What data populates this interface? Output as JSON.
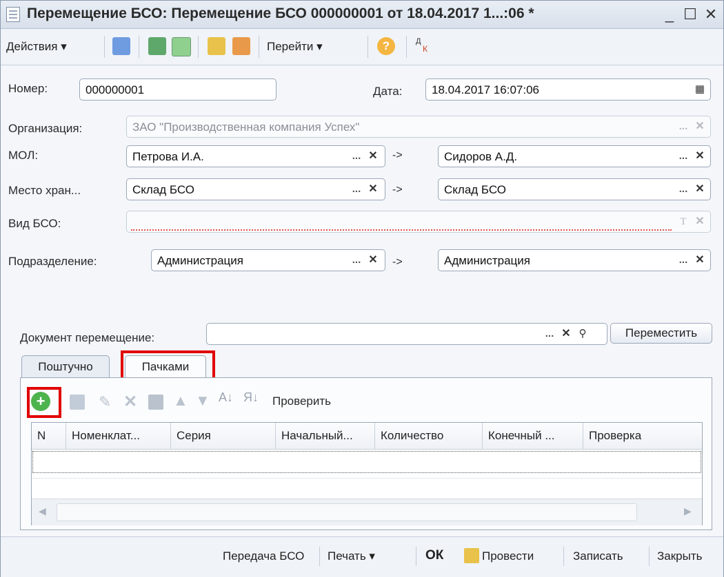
{
  "window": {
    "title": "Перемещение БСО: Перемещение БСО 000000001 от 18.04.2017 1...:06 *",
    "minimize": "_",
    "maximize": "☐",
    "close": "✕"
  },
  "toolbar": {
    "actions_label": "Действия ▾",
    "goto_label": "Перейти ▾",
    "help_label": "?"
  },
  "form": {
    "number_label": "Номер:",
    "number_value": "000000001",
    "date_label": "Дата:",
    "date_value": "18.04.2017 16:07:06",
    "org_label": "Организация:",
    "org_value": "ЗАО \"Производственная компания Успех\"",
    "mol_label": "МОЛ:",
    "mol_from": "Петрова И.А.",
    "mol_to": "Сидоров А.Д.",
    "storage_label": "Место хран...",
    "storage_from": "Склад БСО",
    "storage_to": "Склад БСО",
    "bso_type_label": "Вид БСО:",
    "bso_type_value": "",
    "dept_label": "Подразделение:",
    "dept_from": "Администрация",
    "dept_to": "Администрация",
    "arrow": "->",
    "move_doc_label": "Документ перемещение:",
    "move_doc_value": "",
    "move_button": "Переместить"
  },
  "tabs": [
    {
      "label": "Поштучно"
    },
    {
      "label": "Пачками"
    }
  ],
  "table_toolbar": {
    "check_label": "Проверить"
  },
  "table": {
    "columns": [
      "N",
      "Номенклат...",
      "Серия",
      "Начальный...",
      "Количество",
      "Конечный ...",
      "Проверка"
    ],
    "rows": []
  },
  "footer": {
    "transfer": "Передача БСО",
    "print": "Печать ▾",
    "ok": "ОК",
    "post": "Провести",
    "save": "Записать",
    "close": "Закрыть"
  }
}
